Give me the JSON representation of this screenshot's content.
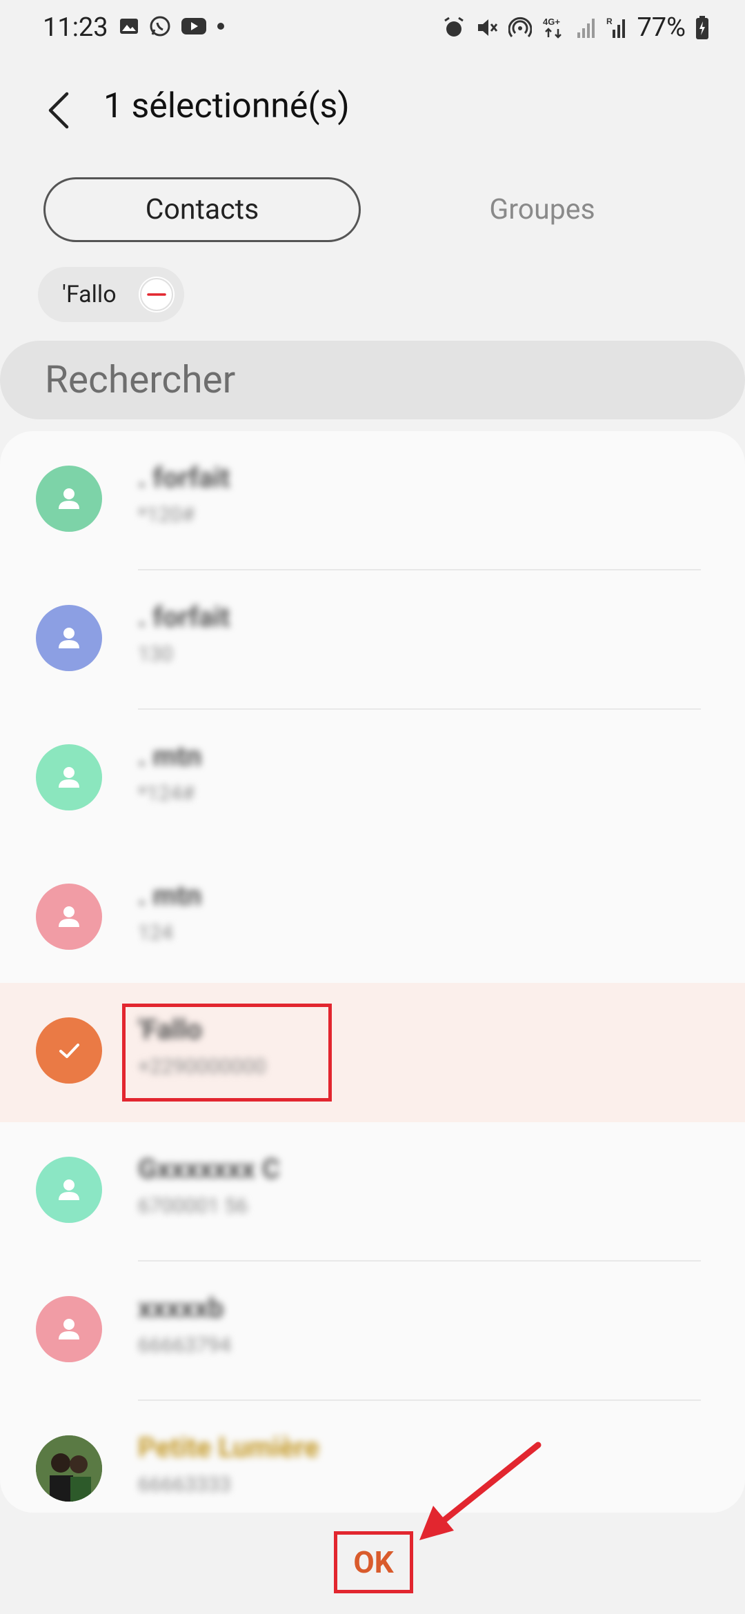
{
  "status_bar": {
    "time": "11:23",
    "battery": "77%",
    "network": "4G+"
  },
  "header": {
    "title": "1 sélectionné(s)"
  },
  "tabs": [
    {
      "label": "Contacts",
      "active": true
    },
    {
      "label": "Groupes",
      "active": false
    }
  ],
  "selected_chip": {
    "label": "'Fallo"
  },
  "search": {
    "placeholder": "Rechercher"
  },
  "contacts": [
    {
      "name": ". forfait",
      "number": "*120#",
      "color": "#7dd3a8"
    },
    {
      "name": ". forfait",
      "number": "130",
      "color": "#8c9fe3"
    },
    {
      "name": ". mtn",
      "number": "*124#",
      "color": "#8be6be"
    },
    {
      "name": ". mtn",
      "number": "124",
      "color": "#f19ca5"
    },
    {
      "name": "'Fallo",
      "number": "+2290000000",
      "color": "#ea7a45",
      "selected": true
    },
    {
      "name": "Gxxxxxxx C",
      "number": "6700001 56",
      "color": "#8be6c4"
    },
    {
      "name": "xxxxxb",
      "number": "66663794",
      "color": "#f19ca5"
    },
    {
      "name": "Petite Lumière",
      "number": "66663333",
      "color": "#4d6b3a",
      "photo": true
    }
  ],
  "footer": {
    "ok_label": "OK"
  },
  "colors": {
    "accent": "#e07235",
    "annotation": "#e2262f",
    "selected_row": "#fbefeb"
  }
}
